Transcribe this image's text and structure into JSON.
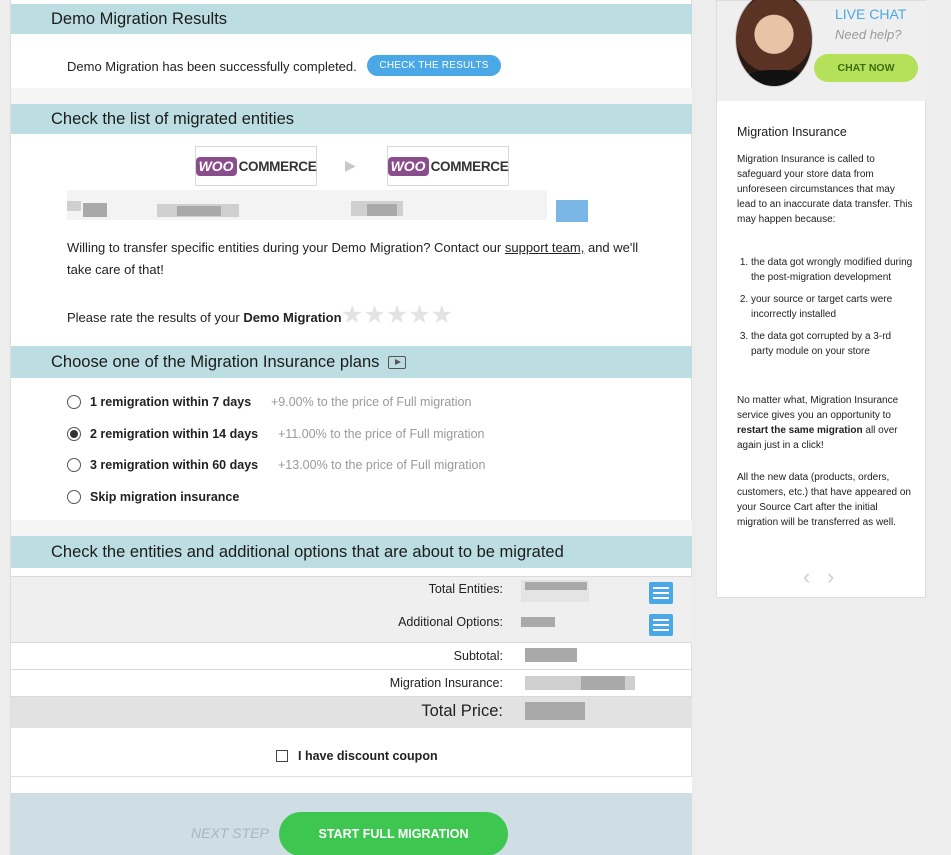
{
  "results": {
    "heading": "Demo Migration Results",
    "message": "Demo Migration has been successfully completed.",
    "check_button": "CHECK THE RESULTS"
  },
  "entities": {
    "heading": "Check the list of migrated entities",
    "source_logo": {
      "badge": "WOO",
      "word": "COMMERCE"
    },
    "target_logo": {
      "badge": "WOO",
      "word": "COMMERCE"
    },
    "arrow": "▶",
    "transfer_text_before": "Willing to transfer specific entities during your Demo Migration? Contact our ",
    "support_link": "support team,",
    "transfer_text_after": " and we'll",
    "transfer_text_line2": "take care of that!",
    "rate_text": "Please rate the results of your ",
    "rate_bold": "Demo Migration",
    "stars": "★★★★★"
  },
  "insurance": {
    "heading": "Choose one of the Migration Insurance plans",
    "video_icon": "film-icon",
    "options": [
      {
        "label": "1 remigration within 7 days",
        "price": "+9.00% to the price of Full migration",
        "selected": false
      },
      {
        "label": "2 remigration within 14 days",
        "price": "+11.00% to the price of Full migration",
        "selected": true
      },
      {
        "label": "3 remigration within 60 days",
        "price": "+13.00% to the price of Full migration",
        "selected": false
      },
      {
        "label": "Skip migration insurance",
        "price": "",
        "selected": false
      }
    ]
  },
  "summary": {
    "heading": "Check the entities and additional options that are about to be migrated",
    "total_entities": "Total Entities:",
    "additional_options": "Additional Options:",
    "subtotal": "Subtotal:",
    "migration_insurance": "Migration Insurance:",
    "total_price": "Total Price:",
    "coupon_label": "I have discount coupon"
  },
  "footer": {
    "next_step": "NEXT STEP",
    "start_button": "START FULL MIGRATION"
  },
  "sidebar": {
    "live_chat": "LIVE CHAT",
    "need_help": "Need help?",
    "chat_now": "CHAT NOW",
    "title": "Migration Insurance",
    "intro": "Migration Insurance is called to safeguard your store data from unforeseen circumstances that may lead to an inaccurate data transfer. This may happen because:",
    "reasons": [
      "the data got wrongly modified during the post-migration development",
      "your source or target carts were incorrectly installed",
      "the data got corrupted by a 3-rd party module on your store"
    ],
    "para2_before": "No matter what, Migration Insurance service gives you an opportunity to ",
    "para2_bold": "restart the same migration",
    "para2_after": " all over again just in a click!",
    "para3": "All the new data (products, orders, customers, etc.) that have appeared on your Source Cart after the initial migration will be transferred as well.",
    "prev": "‹",
    "next": "›"
  },
  "colors": {
    "section_header": "#bcdde1",
    "accent_blue": "#4aa8e6",
    "accent_green": "#3ec750",
    "chat_green": "#b5e05a"
  }
}
